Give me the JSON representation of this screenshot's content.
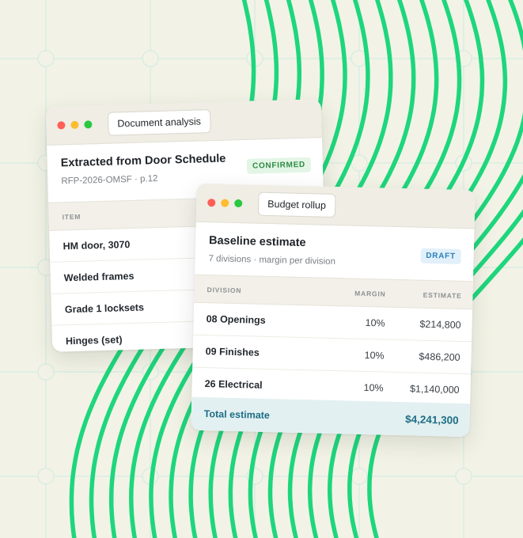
{
  "colors": {
    "background": "#f2f3e6",
    "grid_line": "#d9ece4",
    "wave_stripes": "#1ed67c",
    "window_red": "#ff5f57",
    "window_yellow": "#febc2e",
    "window_green": "#28c840",
    "confirmed_badge": "#2e8a43",
    "draft_badge": "#2a82ba",
    "total_text": "#1d6e86"
  },
  "document_card": {
    "tab_label": "Document analysis",
    "title": "Extracted from Door Schedule",
    "subtitle": "RFP-2026-OMSF · p.12",
    "badge": "CONFIRMED",
    "column_header": "ITEM",
    "items": [
      "HM door, 3070",
      "Welded frames",
      "Grade 1 locksets",
      "Hinges (set)"
    ]
  },
  "budget_card": {
    "tab_label": "Budget rollup",
    "title": "Baseline estimate",
    "subtitle": "7 divisions · margin per division",
    "badge": "DRAFT",
    "columns": {
      "division": "DIVISION",
      "margin": "MARGIN",
      "estimate": "ESTIMATE"
    },
    "rows": [
      {
        "division": "08 Openings",
        "margin": "10%",
        "estimate": "$214,800"
      },
      {
        "division": "09 Finishes",
        "margin": "10%",
        "estimate": "$486,200"
      },
      {
        "division": "26 Electrical",
        "margin": "10%",
        "estimate": "$1,140,000"
      }
    ],
    "total_label": "Total estimate",
    "total_value": "$4,241,300"
  }
}
